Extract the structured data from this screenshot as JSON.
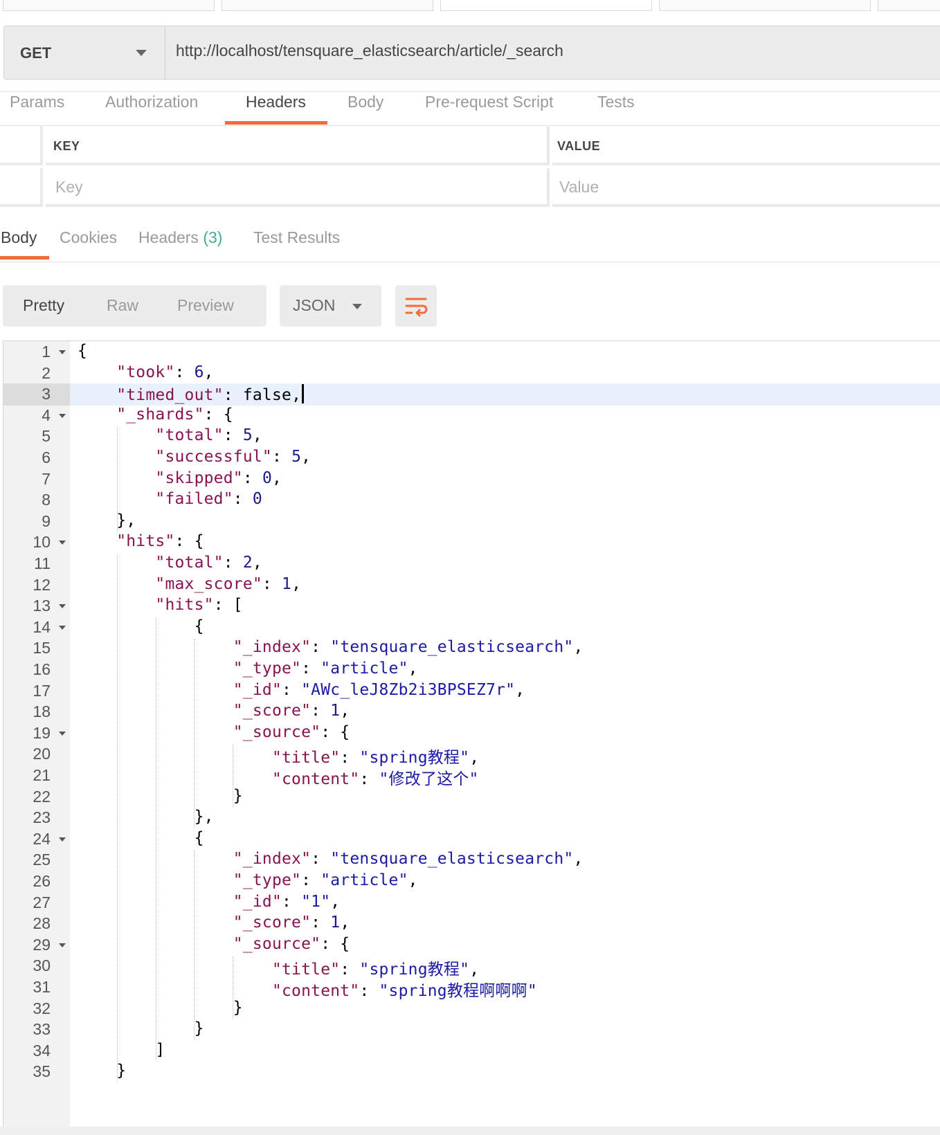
{
  "request": {
    "method": "GET",
    "url": "http://localhost/tensquare_elasticsearch/article/_search"
  },
  "request_tabs": [
    "Params",
    "Authorization",
    "Headers",
    "Body",
    "Pre-request Script",
    "Tests"
  ],
  "request_active_tab": "Headers",
  "headers_table": {
    "key_header": "KEY",
    "value_header": "VALUE",
    "key_placeholder": "Key",
    "value_placeholder": "Value"
  },
  "response_tabs": {
    "body": "Body",
    "cookies": "Cookies",
    "headers": "Headers",
    "headers_count": "(3)",
    "test_results": "Test Results"
  },
  "view_modes": [
    "Pretty",
    "Raw",
    "Preview"
  ],
  "active_view_mode": "Pretty",
  "format": "JSON",
  "colors": {
    "accent": "#f26b3a",
    "count": "#3fae8e",
    "json_key": "#881350",
    "json_string": "#1a1aa6",
    "active_line": "#e8f0fb"
  },
  "icons": [
    "dropdown-caret-icon",
    "wrap-lines-icon",
    "fold-arrow-icon"
  ],
  "cursor_line": 3,
  "code_lines": [
    "{",
    "    \"took\": 6,",
    "    \"timed_out\": false,",
    "    \"_shards\": {",
    "        \"total\": 5,",
    "        \"successful\": 5,",
    "        \"skipped\": 0,",
    "        \"failed\": 0",
    "    },",
    "    \"hits\": {",
    "        \"total\": 2,",
    "        \"max_score\": 1,",
    "        \"hits\": [",
    "            {",
    "                \"_index\": \"tensquare_elasticsearch\",",
    "                \"_type\": \"article\",",
    "                \"_id\": \"AWc_leJ8Zb2i3BPSEZ7r\",",
    "                \"_score\": 1,",
    "                \"_source\": {",
    "                    \"title\": \"spring教程\",",
    "                    \"content\": \"修改了这个\"",
    "                }",
    "            },",
    "            {",
    "                \"_index\": \"tensquare_elasticsearch\",",
    "                \"_type\": \"article\",",
    "                \"_id\": \"1\",",
    "                \"_score\": 1,",
    "                \"_source\": {",
    "                    \"title\": \"spring教程\",",
    "                    \"content\": \"spring教程啊啊啊\"",
    "                }",
    "            }",
    "        ]",
    "    }"
  ],
  "foldable_lines": [
    1,
    4,
    10,
    13,
    14,
    19,
    24,
    29
  ]
}
